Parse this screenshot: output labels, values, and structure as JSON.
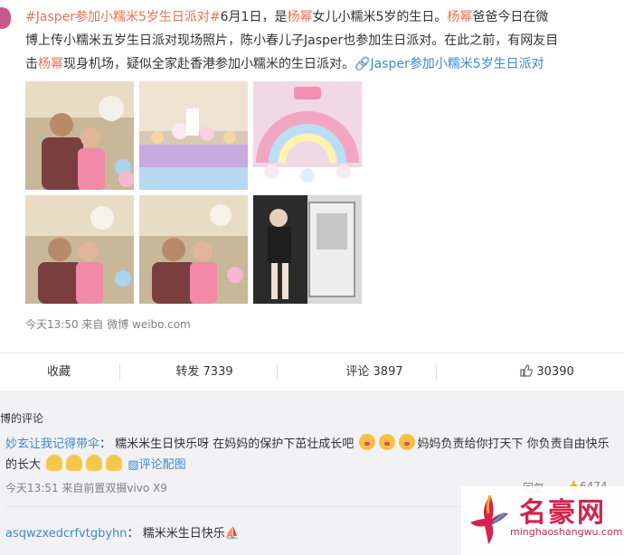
{
  "post": {
    "line1": {
      "tag": "#Jasper参加小糯米5岁生日派对#",
      "t1": "6月1日，是",
      "name1": "杨幂",
      "t2": "女儿小糯米5岁的生日。",
      "name2": "杨幂",
      "t3": "爸爸今日在微"
    },
    "line2": "博上传小糯米五岁生日派对现场照片，陈小春儿子Jasper也参加生日派对。在此之前，有网友目",
    "line3": {
      "t1": "击",
      "name": "杨幂",
      "t2": "现身机场，疑似全家赴香港参加小糯米的生日派对。",
      "link": "Jasper参加小糯米5岁生日派对"
    },
    "meta": "今天13:50 来自 微博 weibo.com"
  },
  "actions": {
    "favorite": "收藏",
    "repost": "转发 7339",
    "comment": "评论 3897",
    "like": "30390"
  },
  "comments": {
    "section_title": "博的评论",
    "items": [
      {
        "user": "妙玄让我记得带伞",
        "colon": "：",
        "text1": "糯米米生日快乐呀 在妈妈的保护下茁壮成长吧",
        "text2": "妈妈负责给你打天下 你负责自由快乐",
        "text3": "的长大",
        "link": "评论配图",
        "meta": "今天13:51 来自前置双摄vivo X9",
        "reply": "回复",
        "likes": "6474"
      },
      {
        "user": "asqwzxedcrfvtgbyhn",
        "colon": "：",
        "text1": "糯米米生日快乐"
      }
    ]
  },
  "watermark": {
    "title": "名豪网",
    "url": "minghaoshangwu.com"
  },
  "colors": {
    "accent_orange": "#eb7350",
    "link_blue": "#3c8ad0",
    "watermark_red": "#d4234e"
  }
}
